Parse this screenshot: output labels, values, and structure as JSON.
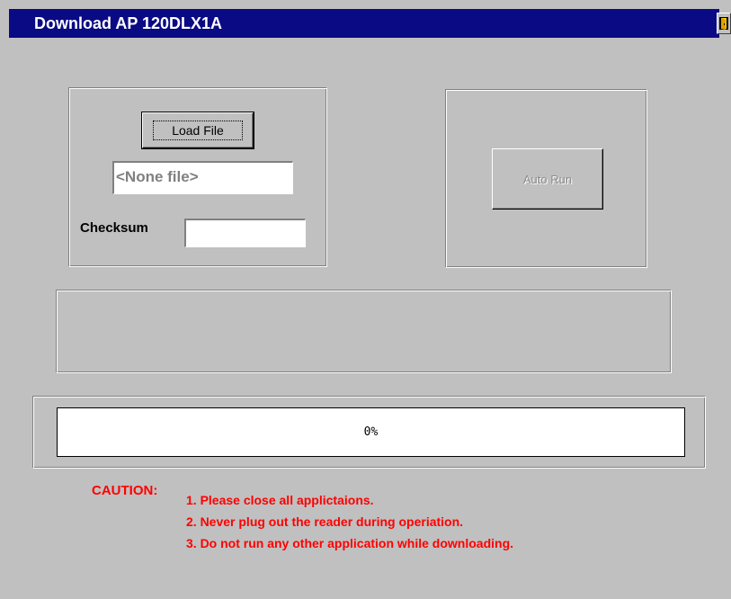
{
  "window": {
    "title": "Download AP 120DLX1A",
    "title_bar_color": "#0a0a84",
    "exit_icon": "exit-door-icon"
  },
  "file_group": {
    "load_button_label": "Load File",
    "file_field_value": "<None file>",
    "checksum_label": "Checksum",
    "checksum_value": ""
  },
  "auto_group": {
    "auto_run_label": "Auto Run",
    "auto_run_enabled": false
  },
  "message_area": {
    "text": ""
  },
  "progress": {
    "value": 0,
    "label": "0%",
    "fill_color": "#0a0a84"
  },
  "caution": {
    "title": "CAUTION:",
    "color": "#ff0000",
    "items": [
      "1. Please close all applictaions.",
      "2. Never plug out the reader during operiation.",
      "3. Do not run any other application while downloading."
    ]
  }
}
